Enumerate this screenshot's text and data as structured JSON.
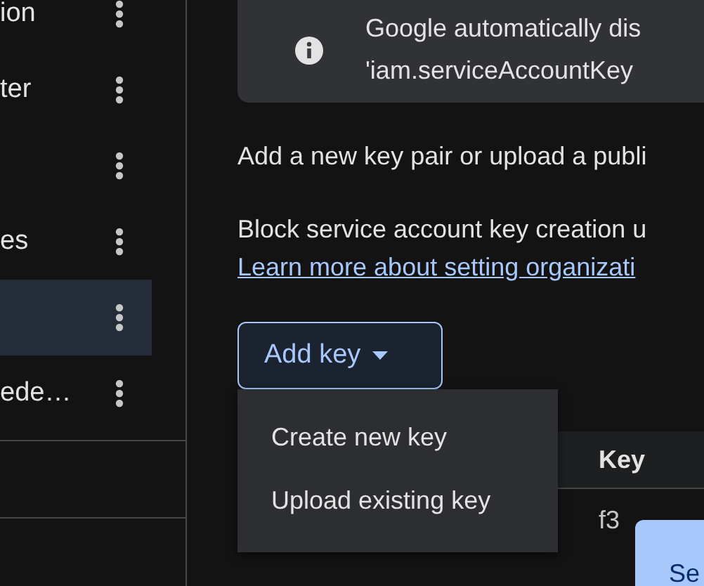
{
  "sidebar": {
    "items": [
      {
        "label": "ion",
        "selected": false
      },
      {
        "label": "ter",
        "selected": false
      },
      {
        "selected": false
      },
      {
        "label": "es",
        "selected": false
      },
      {
        "selected": true
      },
      {
        "label": "ede…",
        "selected": false
      }
    ]
  },
  "info_banner": {
    "lines": [
      "Google automatically dis",
      "'iam.serviceAccountKey"
    ]
  },
  "description": "Add a new key pair or upload a publi",
  "policy_note": "Block service account key creation u",
  "learn_more_link": "Learn more about setting organizati",
  "add_key_button": {
    "label": "Add key",
    "expanded": true
  },
  "add_key_menu": [
    "Create new key",
    "Upload existing key"
  ],
  "table": {
    "columns": [
      "Key"
    ],
    "rows": [
      [
        "f3"
      ]
    ]
  },
  "tooltip": "Se"
}
